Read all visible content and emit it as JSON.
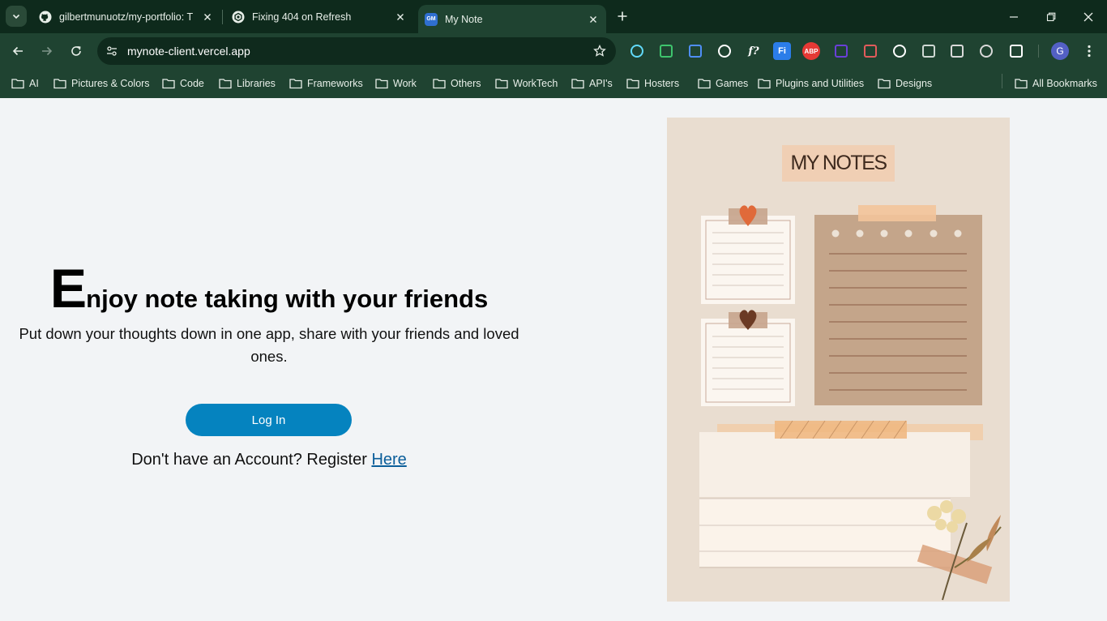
{
  "browser": {
    "tabs": [
      {
        "title": "gilbertmunuotz/my-portfolio: T",
        "icon": "github-icon"
      },
      {
        "title": "Fixing 404 on Refresh",
        "icon": "chatgpt-icon"
      },
      {
        "title": "My Note",
        "icon": "gm-favicon-icon",
        "favicon_text": "GM",
        "active": true
      }
    ],
    "url": "mynote-client.vercel.app",
    "profile_initial": "G",
    "extensions": [
      {
        "name": "react-devtools-icon",
        "label": "",
        "color": "#61dafb"
      },
      {
        "name": "green-ring-icon",
        "label": "",
        "color": "#3ec46d"
      },
      {
        "name": "docs-icon",
        "label": "",
        "color": "#4f8ef7"
      },
      {
        "name": "eyedropper-icon",
        "label": "",
        "color": "#ffffff"
      },
      {
        "name": "font-icon",
        "label": "f?",
        "color": "#ffffff"
      },
      {
        "name": "fi-icon",
        "label": "Fi",
        "color": "#2b7de9"
      },
      {
        "name": "abp-icon",
        "label": "ABP",
        "color": "#e53935"
      },
      {
        "name": "cube-icon",
        "label": "",
        "color": "#6a3fd8"
      },
      {
        "name": "glasses-icon",
        "label": "",
        "color": "#e25b5b"
      },
      {
        "name": "mask-icon",
        "label": "",
        "color": "#ffffff"
      },
      {
        "name": "vue-icon",
        "label": "",
        "color": "#cfd8d3"
      },
      {
        "name": "angular-icon",
        "label": "",
        "color": "#d9d9d9"
      },
      {
        "name": "image-ext-icon",
        "label": "",
        "color": "#d9d9d9"
      },
      {
        "name": "puzzle-icon",
        "label": "",
        "color": "#ffffff"
      }
    ],
    "bookmarks": [
      "AI",
      "Pictures & Colors",
      "Code",
      "Libraries",
      "Frameworks",
      "Work",
      "Others",
      "WorkTech",
      "API's",
      "Hosters",
      "Games",
      "Plugins and Utilities",
      "Designs"
    ],
    "all_bookmarks": "All Bookmarks",
    "chrome_colors": {
      "tabbar": "#0e2a1c",
      "toolbar": "#1f4331"
    }
  },
  "page": {
    "headline_cap": "E",
    "headline_rest": "njoy note taking with your friends",
    "subtitle": "Put down your thoughts down in one app, share with your friends and loved ones.",
    "login_label": "Log In",
    "register_prompt": "Don't have an Account? Register ",
    "register_link": "Here",
    "accent": "#0583bf",
    "illustration": {
      "title": "MY NOTES",
      "background": "#e9ddd0"
    }
  }
}
